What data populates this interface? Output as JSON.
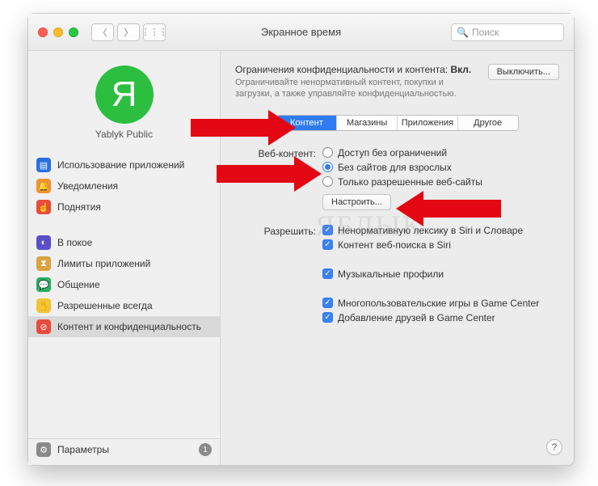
{
  "window": {
    "title": "Экранное время",
    "search_placeholder": "Поиск"
  },
  "profile": {
    "initial": "Я",
    "name": "Yablyk Public"
  },
  "sidebar": {
    "group1": [
      {
        "label": "Использование приложений"
      },
      {
        "label": "Уведомления"
      },
      {
        "label": "Поднятия"
      }
    ],
    "group2": [
      {
        "label": "В покое"
      },
      {
        "label": "Лимиты приложений"
      },
      {
        "label": "Общение"
      },
      {
        "label": "Разрешенные всегда"
      },
      {
        "label": "Контент и конфиденциальность"
      }
    ],
    "footer": {
      "label": "Параметры",
      "badge": "1"
    }
  },
  "header": {
    "title_prefix": "Ограничения конфиденциальности и контента: ",
    "title_state": "Вкл.",
    "subtitle": "Ограничивайте ненормативный контент, покупки и загрузки, а также управляйте конфиденциальностью.",
    "off_button": "Выключить..."
  },
  "tabs": [
    "Контент",
    "Магазины",
    "Приложения",
    "Другое"
  ],
  "form": {
    "web_label": "Веб-контент:",
    "web_options": [
      "Доступ без ограничений",
      "Без сайтов для взрослых",
      "Только разрешенные веб-сайты"
    ],
    "configure_btn": "Настроить...",
    "allow_label": "Разрешить:",
    "allow_options": [
      "Ненормативную лексику в Siri и Словаре",
      "Контент веб-поиска в Siri",
      "Музыкальные профили",
      "Многопользовательские игры в Game Center",
      "Добавление друзей в Game Center"
    ]
  },
  "watermark": "ЯБЛЫК"
}
